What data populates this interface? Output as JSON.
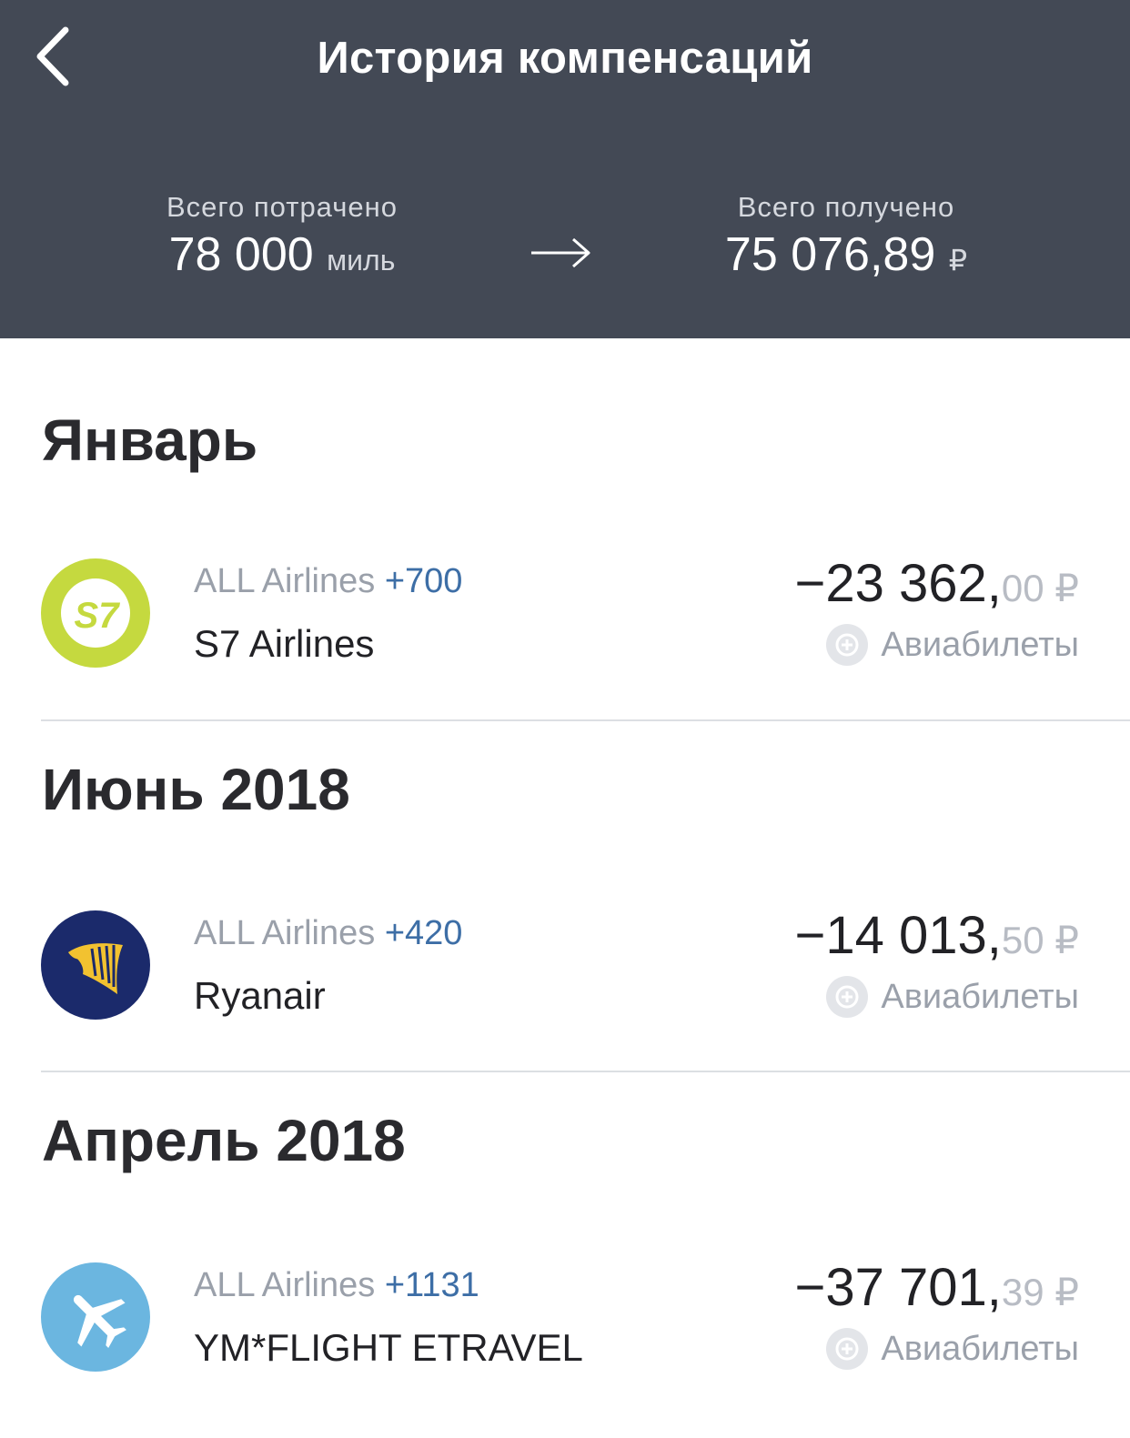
{
  "header": {
    "title": "История компенсаций",
    "spent": {
      "label": "Всего потрачено",
      "value": "78 000",
      "unit": "миль"
    },
    "received": {
      "label": "Всего получено",
      "value": "75 076,89",
      "unit": "₽"
    }
  },
  "sections": [
    {
      "month": "Январь",
      "transactions": [
        {
          "program": "ALL Airlines",
          "bonus": "+700",
          "merchant": "S7 Airlines",
          "amount_main": "−23 362,",
          "amount_cents": "00 ₽",
          "category": "Авиабилеты",
          "logo_text": "S7",
          "logo_color": "#c5d93f"
        }
      ]
    },
    {
      "month": "Июнь 2018",
      "transactions": [
        {
          "program": "ALL Airlines",
          "bonus": "+420",
          "merchant": "Ryanair",
          "amount_main": "−14 013,",
          "amount_cents": "50 ₽",
          "category": "Авиабилеты",
          "logo_color": "#1b2a6b"
        }
      ]
    },
    {
      "month": "Апрель 2018",
      "transactions": [
        {
          "program": "ALL Airlines",
          "bonus": "+1131",
          "merchant": "YM*FLIGHT ETRAVEL",
          "amount_main": "−37 701,",
          "amount_cents": "39 ₽",
          "category": "Авиабилеты",
          "logo_color": "#6bb6e0"
        }
      ]
    }
  ],
  "icons": {
    "back": "chevron-left-icon",
    "arrow": "arrow-right-icon",
    "category": "plus-circle-icon",
    "s7": "s7-airlines-logo",
    "ryanair": "ryanair-harp-logo",
    "plane": "airplane-icon"
  }
}
